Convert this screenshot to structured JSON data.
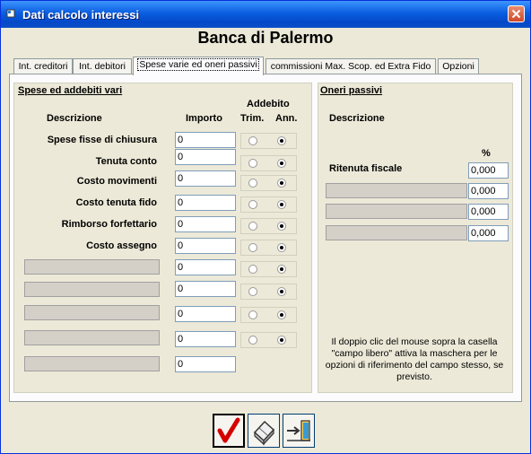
{
  "window": {
    "title": "Dati calcolo interessi"
  },
  "header": {
    "bank_name": "Banca di Palermo"
  },
  "tabs": [
    {
      "label": "Int. creditori",
      "active": false
    },
    {
      "label": "Int. debitori",
      "active": false
    },
    {
      "label": "Spese varie ed oneri passivi",
      "active": true
    },
    {
      "label": "commissioni Max. Scop. ed Extra Fido",
      "active": false
    },
    {
      "label": "Opzioni",
      "active": false
    }
  ],
  "spese": {
    "title": "Spese ed addebiti vari",
    "col_descrizione": "Descrizione",
    "col_importo": "Importo",
    "col_addebito": "Addebito",
    "col_trim": "Trim.",
    "col_ann": "Ann.",
    "rows": [
      {
        "label": "Spese fisse di chiusura",
        "value": "0",
        "selected": "ann"
      },
      {
        "label": "Tenuta conto",
        "value": "0",
        "selected": "ann"
      },
      {
        "label": "Costo movimenti",
        "value": "0",
        "selected": "ann"
      },
      {
        "label": "Costo tenuta fido",
        "value": "0",
        "selected": "ann"
      },
      {
        "label": "Rimborso forfettario",
        "value": "0",
        "selected": "ann"
      },
      {
        "label": "Costo assegno",
        "value": "0",
        "selected": "ann"
      },
      {
        "label": "",
        "value": "0",
        "selected": "ann"
      },
      {
        "label": "",
        "value": "0",
        "selected": "ann"
      },
      {
        "label": "",
        "value": "0",
        "selected": "ann"
      },
      {
        "label": "",
        "value": "0",
        "selected": "ann"
      },
      {
        "label": "",
        "value": "0",
        "selected": null
      }
    ]
  },
  "oneri": {
    "title": "Oneri passivi",
    "col_descrizione": "Descrizione",
    "col_percent": "%",
    "rows": [
      {
        "label": "Ritenuta fiscale",
        "value": "0,000"
      },
      {
        "label": "",
        "value": "0,000"
      },
      {
        "label": "",
        "value": "0,000"
      },
      {
        "label": "",
        "value": "0,000"
      }
    ],
    "note": "Il doppio clic del mouse sopra la casella \"campo libero\" attiva la maschera per le opzioni di riferimento del campo stesso, se previsto."
  },
  "buttons": [
    {
      "name": "confirm",
      "icon": "check-icon"
    },
    {
      "name": "cancel",
      "icon": "eraser-icon"
    },
    {
      "name": "exit",
      "icon": "exit-door-icon"
    }
  ],
  "colors": {
    "titlebar": "#0a5ee0",
    "face": "#ece9d8",
    "check": "#d40000"
  }
}
